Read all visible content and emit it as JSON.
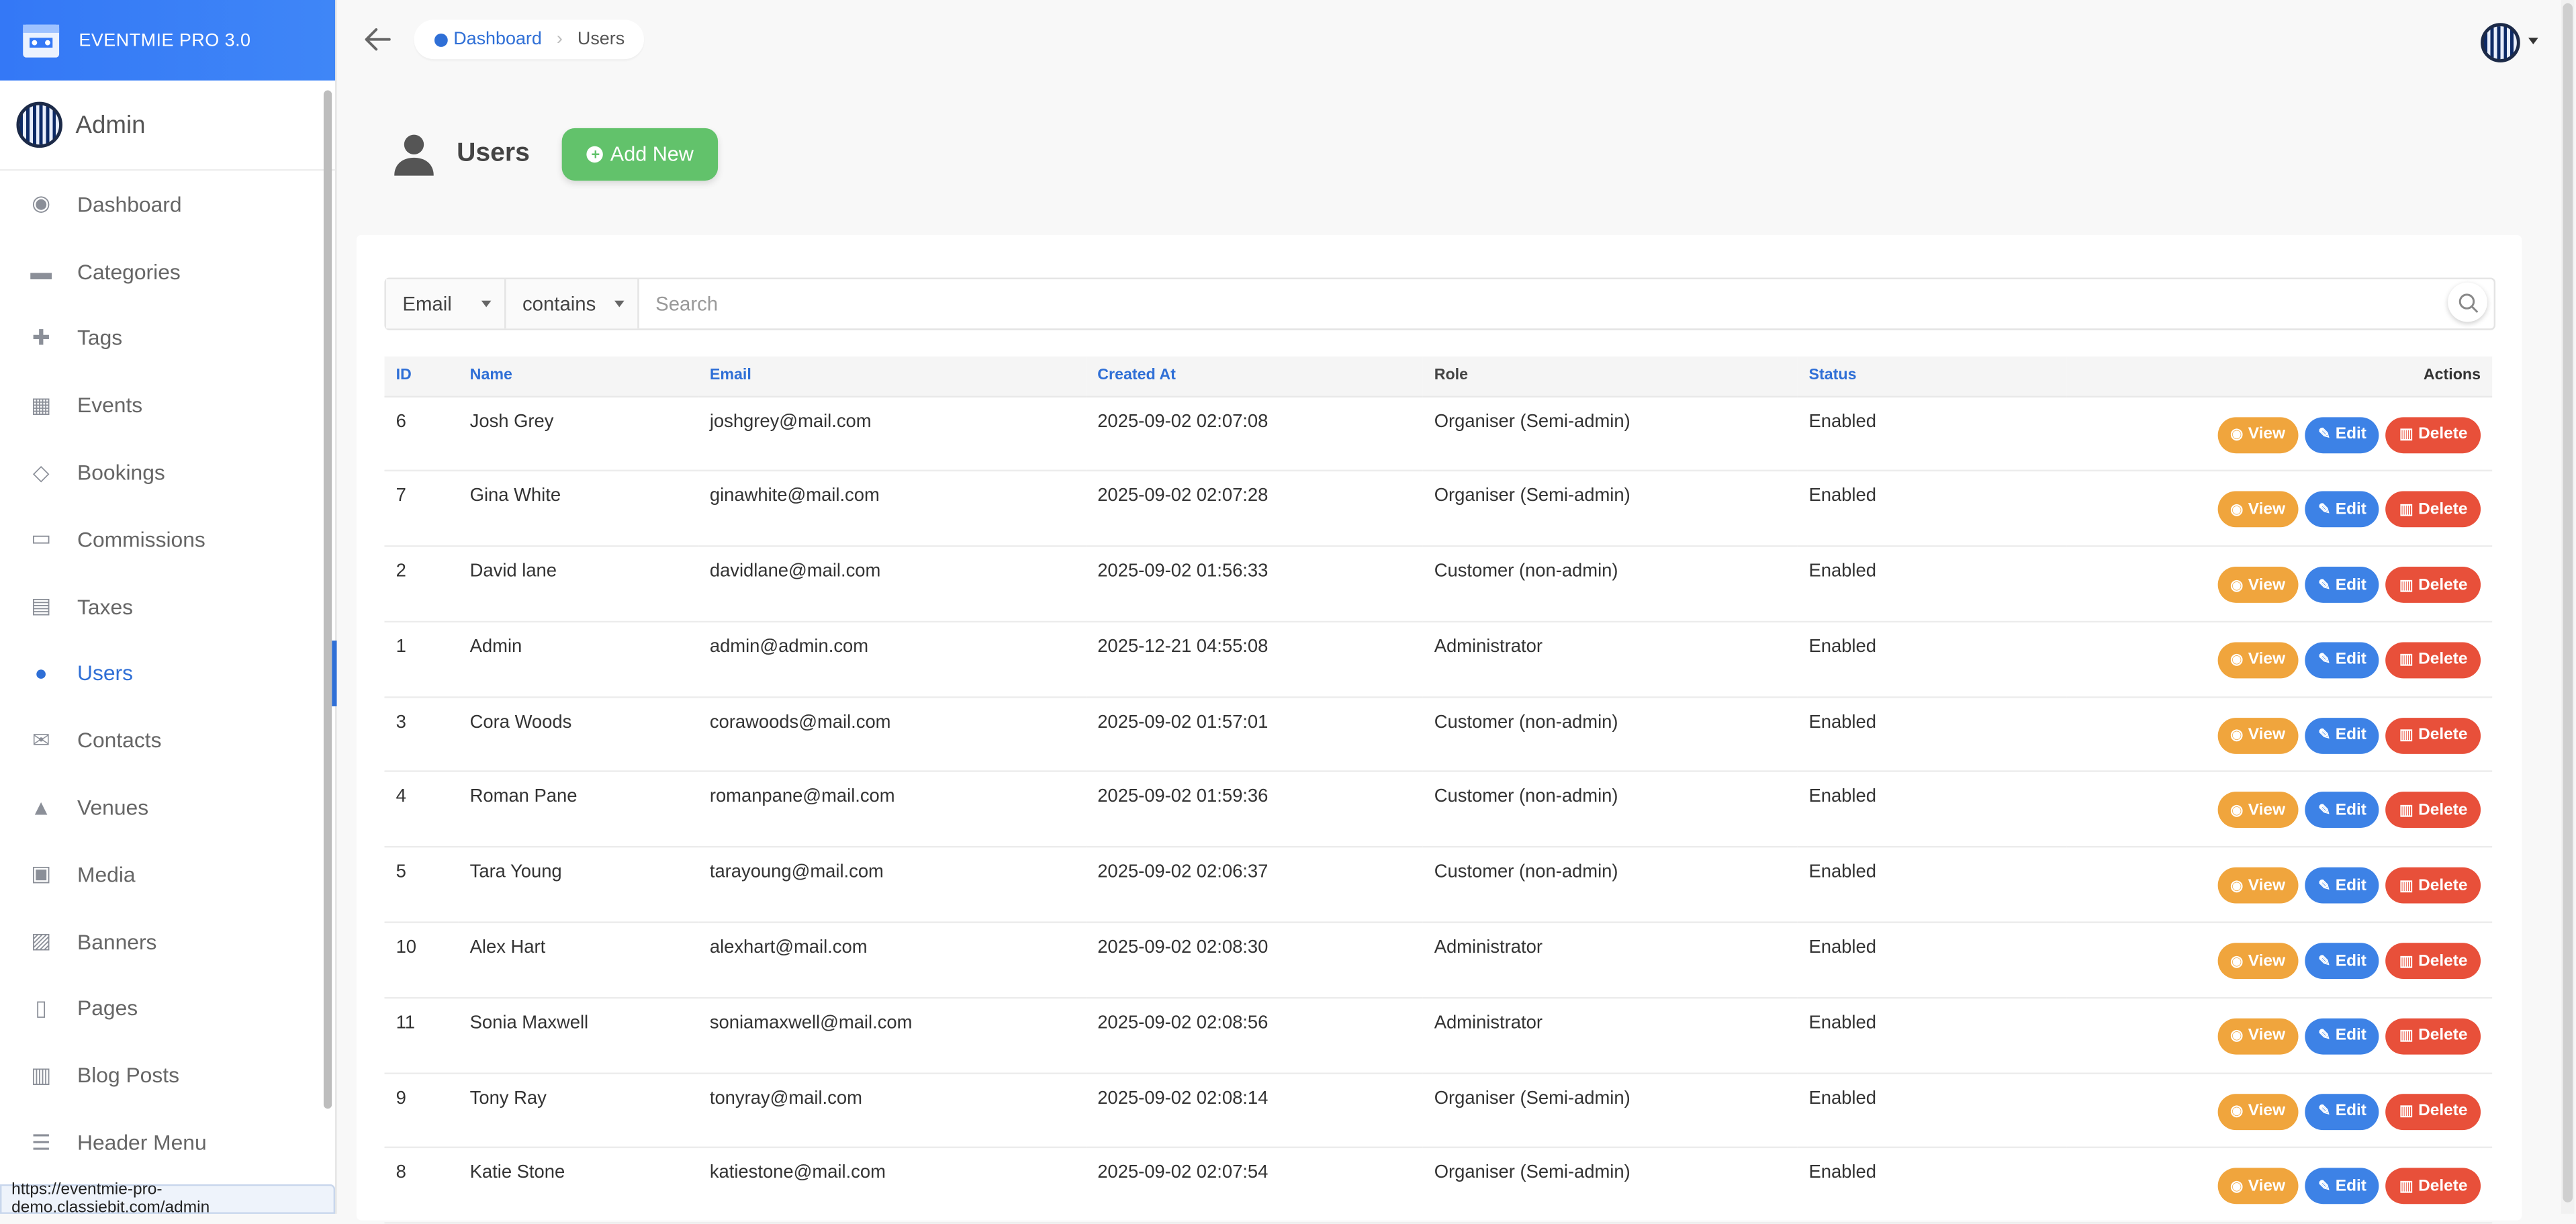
{
  "brand": {
    "title": "EVENTMIE PRO 3.0"
  },
  "admin": {
    "name": "Admin"
  },
  "sidebar": {
    "items": [
      {
        "label": "Dashboard",
        "icon": "dashboard-icon"
      },
      {
        "label": "Categories",
        "icon": "folder-icon"
      },
      {
        "label": "Tags",
        "icon": "puzzle-icon"
      },
      {
        "label": "Events",
        "icon": "calendar-icon"
      },
      {
        "label": "Bookings",
        "icon": "tag-icon"
      },
      {
        "label": "Commissions",
        "icon": "wallet-icon"
      },
      {
        "label": "Taxes",
        "icon": "receipt-icon"
      },
      {
        "label": "Users",
        "icon": "people-icon",
        "active": true
      },
      {
        "label": "Contacts",
        "icon": "envelope-icon"
      },
      {
        "label": "Venues",
        "icon": "tower-icon"
      },
      {
        "label": "Media",
        "icon": "images-icon"
      },
      {
        "label": "Banners",
        "icon": "image-icon"
      },
      {
        "label": "Pages",
        "icon": "file-icon"
      },
      {
        "label": "Blog Posts",
        "icon": "blog-icon"
      },
      {
        "label": "Header Menu",
        "icon": "list-icon"
      }
    ]
  },
  "status_url": "https://eventmie-pro-demo.classiebit.com/admin",
  "breadcrumb": {
    "home": "Dashboard",
    "current": "Users"
  },
  "page": {
    "title": "Users",
    "add_label": "Add New"
  },
  "filter": {
    "field": "Email",
    "operator": "contains",
    "placeholder": "Search"
  },
  "table": {
    "headers": {
      "id": "ID",
      "name": "Name",
      "email": "Email",
      "created": "Created At",
      "role": "Role",
      "status": "Status",
      "actions": "Actions"
    },
    "actions": {
      "view": "View",
      "edit": "Edit",
      "delete": "Delete"
    },
    "rows": [
      {
        "id": "6",
        "name": "Josh Grey",
        "email": "joshgrey@mail.com",
        "created": "2025-09-02 02:07:08",
        "role": "Organiser (Semi-admin)",
        "status": "Enabled"
      },
      {
        "id": "7",
        "name": "Gina White",
        "email": "ginawhite@mail.com",
        "created": "2025-09-02 02:07:28",
        "role": "Organiser (Semi-admin)",
        "status": "Enabled"
      },
      {
        "id": "2",
        "name": "David lane",
        "email": "davidlane@mail.com",
        "created": "2025-09-02 01:56:33",
        "role": "Customer (non-admin)",
        "status": "Enabled"
      },
      {
        "id": "1",
        "name": "Admin",
        "email": "admin@admin.com",
        "created": "2025-12-21 04:55:08",
        "role": "Administrator",
        "status": "Enabled"
      },
      {
        "id": "3",
        "name": "Cora Woods",
        "email": "corawoods@mail.com",
        "created": "2025-09-02 01:57:01",
        "role": "Customer (non-admin)",
        "status": "Enabled"
      },
      {
        "id": "4",
        "name": "Roman Pane",
        "email": "romanpane@mail.com",
        "created": "2025-09-02 01:59:36",
        "role": "Customer (non-admin)",
        "status": "Enabled"
      },
      {
        "id": "5",
        "name": "Tara Young",
        "email": "tarayoung@mail.com",
        "created": "2025-09-02 02:06:37",
        "role": "Customer (non-admin)",
        "status": "Enabled"
      },
      {
        "id": "10",
        "name": "Alex Hart",
        "email": "alexhart@mail.com",
        "created": "2025-09-02 02:08:30",
        "role": "Administrator",
        "status": "Enabled"
      },
      {
        "id": "11",
        "name": "Sonia Maxwell",
        "email": "soniamaxwell@mail.com",
        "created": "2025-09-02 02:08:56",
        "role": "Administrator",
        "status": "Enabled"
      },
      {
        "id": "9",
        "name": "Tony Ray",
        "email": "tonyray@mail.com",
        "created": "2025-09-02 02:08:14",
        "role": "Organiser (Semi-admin)",
        "status": "Enabled"
      },
      {
        "id": "8",
        "name": "Katie Stone",
        "email": "katiestone@mail.com",
        "created": "2025-09-02 02:07:54",
        "role": "Organiser (Semi-admin)",
        "status": "Enabled"
      }
    ]
  },
  "colors": {
    "brand": "#3478f6",
    "active": "#2f6fd6",
    "add": "#62c26b",
    "view": "#f0a53d",
    "edit": "#3d82e6",
    "delete": "#e8503a"
  }
}
